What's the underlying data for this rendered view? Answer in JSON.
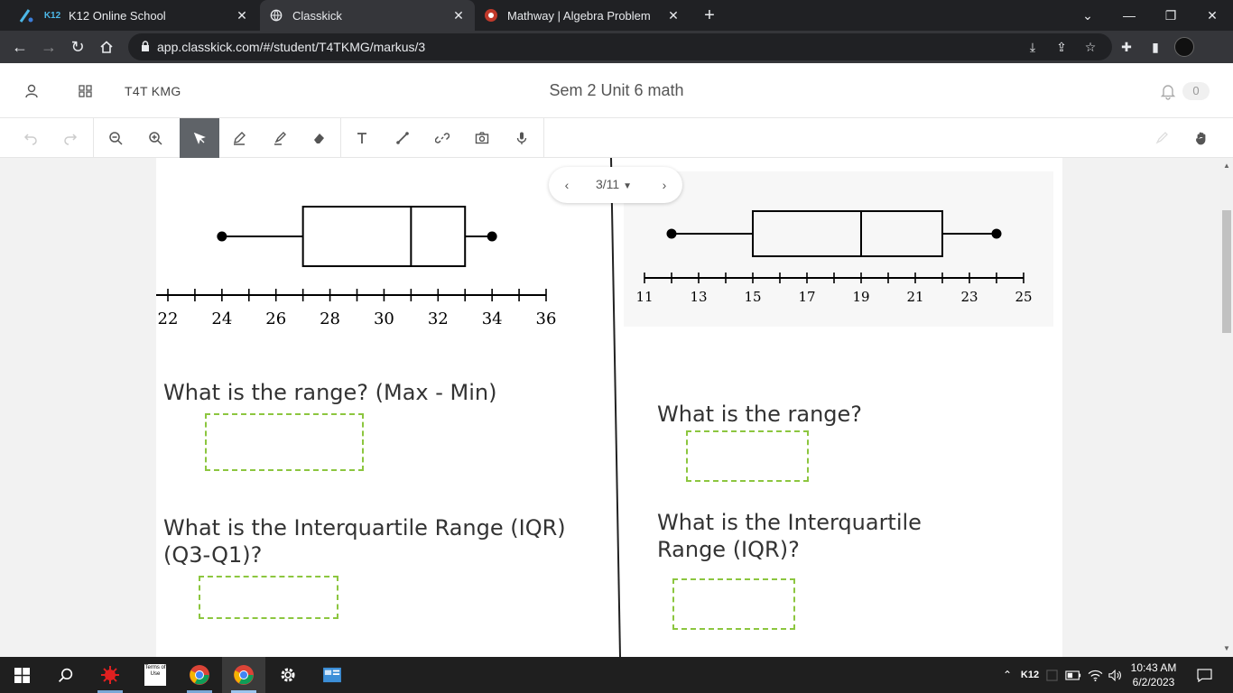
{
  "browser": {
    "tabs": [
      {
        "label": "K12 Online School",
        "favicon": "K12"
      },
      {
        "label": "Classkick",
        "favicon": "globe"
      },
      {
        "label": "Mathway | Algebra Problem Solver",
        "favicon": "mathway"
      }
    ],
    "url": "app.classkick.com/#/student/T4TKMG/markus/3"
  },
  "app": {
    "class_code": "T4T KMG",
    "title": "Sem 2 Unit 6 math",
    "notification_count": "0"
  },
  "pager": {
    "label": "3/11"
  },
  "plot_left": {
    "ticks": [
      "22",
      "24",
      "26",
      "28",
      "30",
      "32",
      "34",
      "36"
    ],
    "min": 24,
    "q1": 27,
    "median": 31,
    "q3": 33,
    "max": 34,
    "range": [
      22,
      36
    ]
  },
  "plot_right": {
    "ticks": [
      "11",
      "13",
      "15",
      "17",
      "19",
      "21",
      "23",
      "25"
    ],
    "min": 12,
    "q1": 15,
    "median": 19,
    "q3": 22,
    "max": 24,
    "range": [
      11,
      25
    ]
  },
  "questions": {
    "left_range": "What is the range? (Max - Min)",
    "left_iqr_1": "What is the Interquartile Range (IQR)",
    "left_iqr_2": "(Q3-Q1)?",
    "right_range": "What is the range?",
    "right_iqr_1": "What is the Interquartile",
    "right_iqr_2": "Range (IQR)?"
  },
  "taskbar": {
    "tray_label": "K12",
    "time": "10:43 AM",
    "date": "6/2/2023",
    "terms_label": "Terms of Use"
  },
  "colors": {
    "answer_border": "#8cc63f",
    "active_tool": "#5f6368"
  }
}
